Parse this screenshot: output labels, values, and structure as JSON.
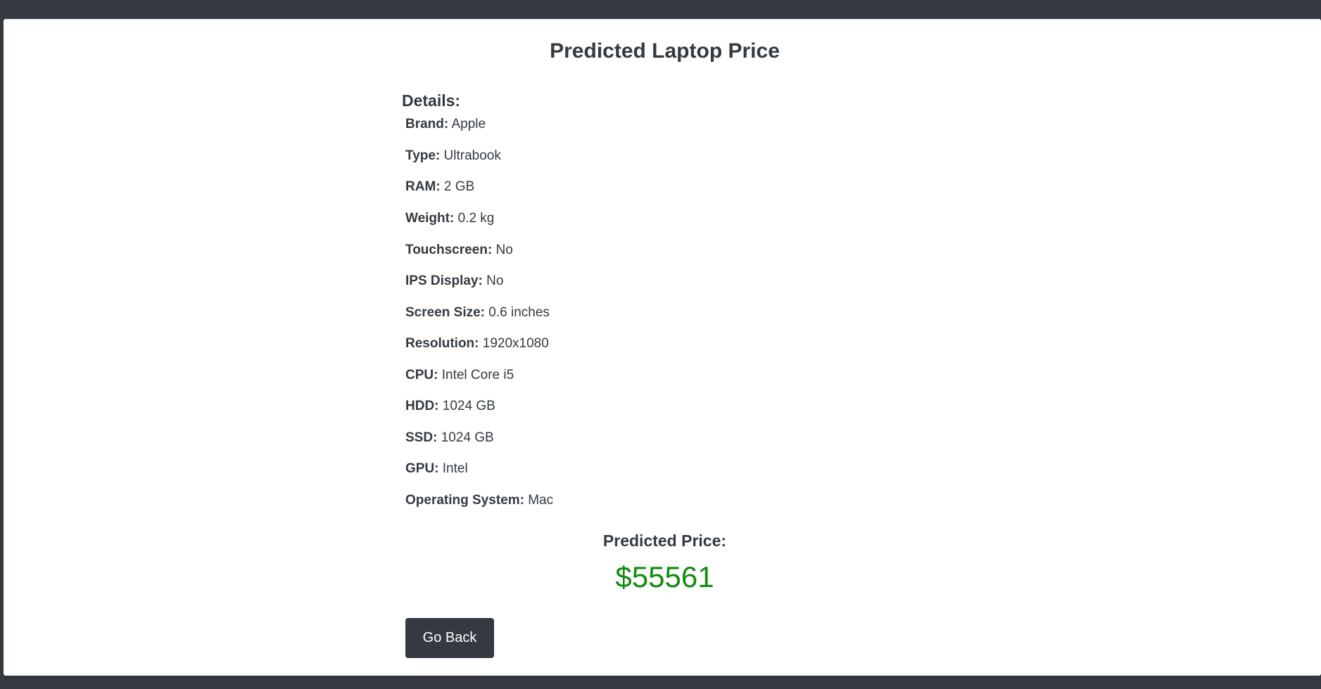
{
  "page": {
    "title": "Predicted Laptop Price",
    "details_heading": "Details:"
  },
  "details": [
    {
      "label": "Brand:",
      "value": "Apple"
    },
    {
      "label": "Type:",
      "value": "Ultrabook"
    },
    {
      "label": "RAM:",
      "value": "2 GB"
    },
    {
      "label": "Weight:",
      "value": "0.2 kg"
    },
    {
      "label": "Touchscreen:",
      "value": "No"
    },
    {
      "label": "IPS Display:",
      "value": "No"
    },
    {
      "label": "Screen Size:",
      "value": "0.6 inches"
    },
    {
      "label": "Resolution:",
      "value": "1920x1080"
    },
    {
      "label": "CPU:",
      "value": "Intel Core i5"
    },
    {
      "label": "HDD:",
      "value": "1024 GB"
    },
    {
      "label": "SSD:",
      "value": "1024 GB"
    },
    {
      "label": "GPU:",
      "value": "Intel"
    },
    {
      "label": "Operating System:",
      "value": "Mac"
    }
  ],
  "prediction": {
    "label": "Predicted Price:",
    "value": "$55561",
    "color": "#118b11"
  },
  "actions": {
    "back_label": "Go Back"
  },
  "colors": {
    "header_bar": "#343a40",
    "text": "#343a40",
    "button_bg": "#343a40"
  }
}
